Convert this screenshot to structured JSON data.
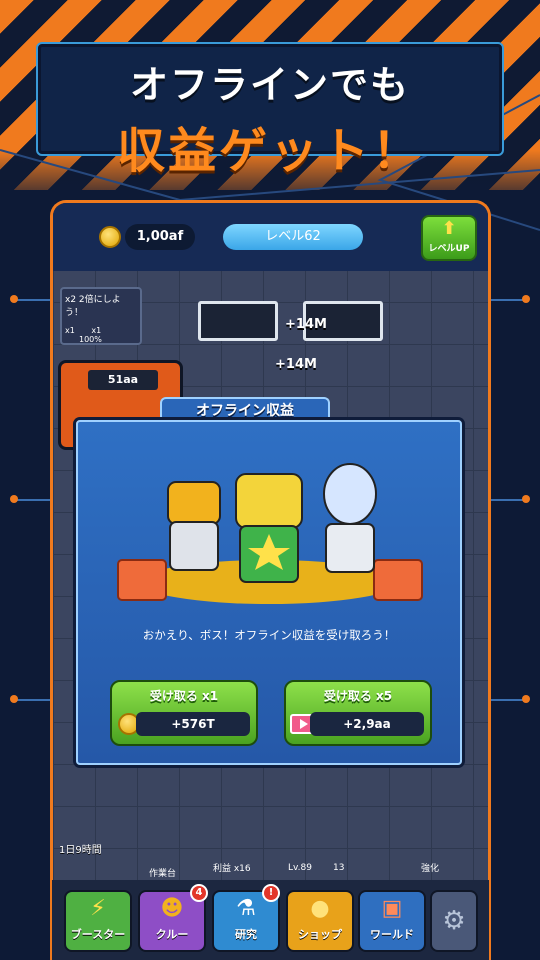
{
  "headline": {
    "line1": "オフラインでも",
    "line2": "収益ゲット！"
  },
  "topbar": {
    "coins": "1,00af",
    "level": "レベル62",
    "levelup_label": "レベルUP"
  },
  "factory": {
    "boost_title": "x2  2倍にしよう！",
    "boost_x1": "x1",
    "boost_x1b": "x1",
    "boost_pct": "100%",
    "station_value": "51aa",
    "float_1": "+14M",
    "float_2": "+14M",
    "time_left": "1日9時間",
    "workbench": "作業台",
    "profit": "利益 x16",
    "lv": "Lv.89",
    "count": "13",
    "strengthen": "強化"
  },
  "modal": {
    "title": "オフライン収益",
    "message": "おかえり、ボス！オフライン収益を受け取ろう！",
    "claim_x1": {
      "label": "受け取る x1",
      "value": "+576T"
    },
    "claim_x5": {
      "label": "受け取る x5",
      "value": "+2,9aa"
    }
  },
  "nav": [
    {
      "label": "ブースター",
      "icon": "lightning-icon",
      "color": "#4fb042"
    },
    {
      "label": "クルー",
      "icon": "robot-icon",
      "color": "#8e4ec6",
      "badge": "4"
    },
    {
      "label": "研究",
      "icon": "flask-icon",
      "color": "#2f8bd1",
      "badge": "!"
    },
    {
      "label": "ショップ",
      "icon": "coins-icon",
      "color": "#e8a21a"
    },
    {
      "label": "ワールド",
      "icon": "factory-icon",
      "color": "#2f6fc0"
    }
  ],
  "colors": {
    "accent_orange": "#f07a1e",
    "headline_orange": "#ff8a1e",
    "button_green": "#6ccf35",
    "modal_blue": "#2b67bd"
  }
}
